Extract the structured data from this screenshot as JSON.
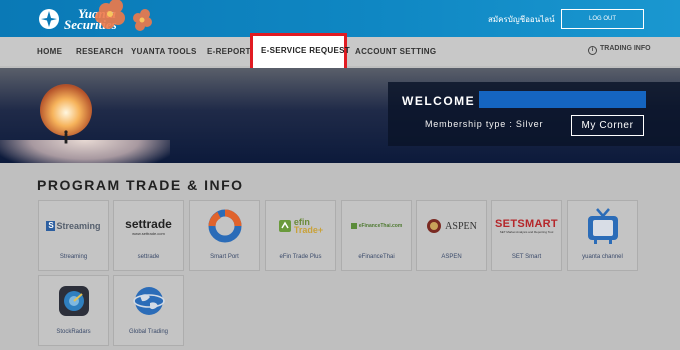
{
  "header": {
    "logo_line1": "Yuanta",
    "logo_line2": "Securities",
    "signup": "สมัครบัญชีออนไลน์",
    "logout": "LOG OUT"
  },
  "nav": {
    "items": [
      "HOME",
      "RESEARCH",
      "YUANTA TOOLS",
      "E-REPORT",
      "E-SERVICE REQUEST",
      "ACCOUNT SETTING"
    ],
    "trading_info": "TRADING INFO"
  },
  "banner": {
    "welcome": "WELCOME :",
    "membership": "Membership type : Silver",
    "my_corner": "My Corner"
  },
  "program": {
    "title": "PROGRAM TRADE & INFO",
    "tiles": [
      {
        "label": "Streaming",
        "logo": "Streaming"
      },
      {
        "label": "settrade",
        "logo": "settrade",
        "logo_sub": "www.settrade.com"
      },
      {
        "label": "Smart Port",
        "logo": ""
      },
      {
        "label": "eFin Trade Plus",
        "logo": "efin",
        "logo_sub": "Trade+"
      },
      {
        "label": "eFinanceThai",
        "logo": "eFinanceThai.com"
      },
      {
        "label": "ASPEN",
        "logo": "ASPEN"
      },
      {
        "label": "SET Smart",
        "logo": "SETSMART",
        "logo_sub": "SET Market Analysis and Reporting Tool"
      },
      {
        "label": "yuanta channel",
        "logo": ""
      },
      {
        "label": "StockRadars",
        "logo": ""
      },
      {
        "label": "Global Trading",
        "logo": ""
      }
    ]
  },
  "colors": {
    "header_blue": "#0a79b6",
    "highlight_red": "#e11b22",
    "name_bar": "#1565c0"
  }
}
